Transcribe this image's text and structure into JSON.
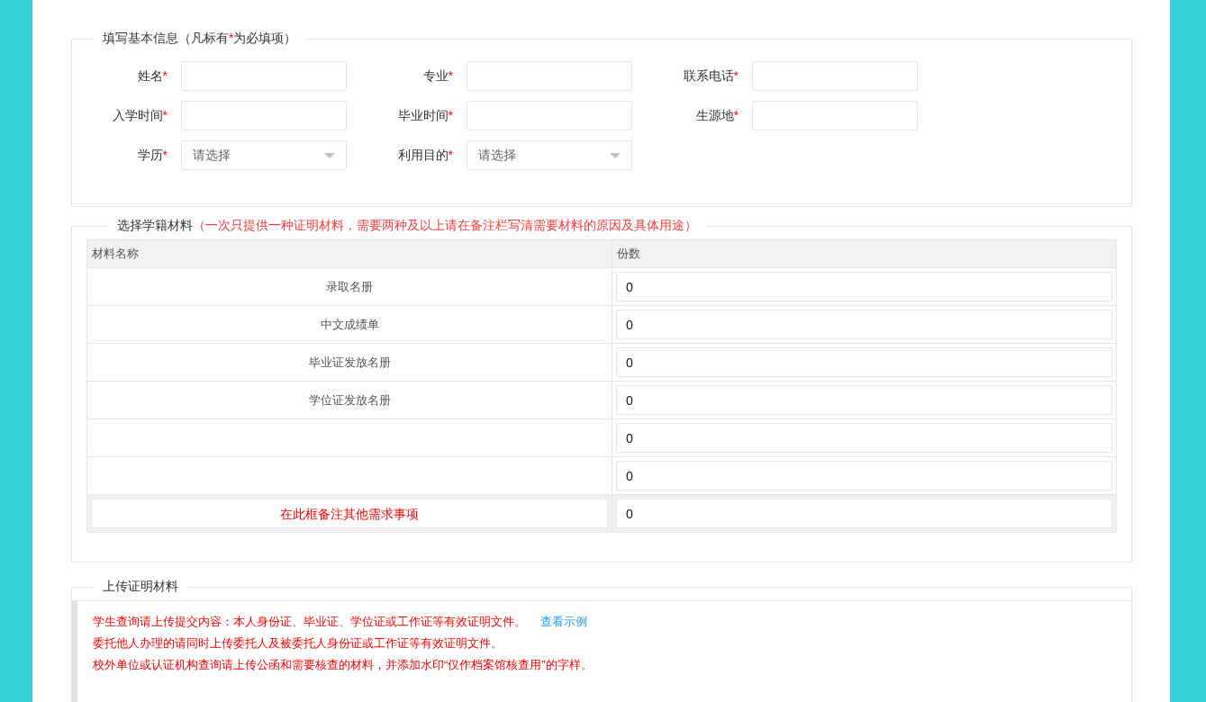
{
  "basic_info": {
    "legend": [
      {
        "text": "填写基本信息（凡标有",
        "kind": "normal"
      },
      {
        "text": "*",
        "kind": "required"
      },
      {
        "text": "为必填项）",
        "kind": "normal"
      }
    ],
    "rows": [
      [
        {
          "label": "姓名",
          "required": true,
          "kind": "text"
        },
        {
          "label": "专业",
          "required": true,
          "kind": "text"
        },
        {
          "label": "联系电话",
          "required": true,
          "kind": "text"
        }
      ],
      [
        {
          "label": "入学时间",
          "required": true,
          "kind": "text"
        },
        {
          "label": "毕业时间",
          "required": true,
          "kind": "text"
        },
        {
          "label": "生源地",
          "required": true,
          "kind": "text"
        }
      ],
      [
        {
          "label": "学历",
          "required": true,
          "kind": "select",
          "placeholder": "请选择"
        },
        {
          "label": "利用目的",
          "required": true,
          "kind": "select",
          "placeholder": "请选择"
        }
      ]
    ]
  },
  "materials": {
    "legend": "选择学籍材料",
    "legend_note": "（一次只提供一种证明材料，需要两种及以上请在备注栏写清需要材料的原因及具体用途）",
    "columns": [
      "材料名称",
      "份数"
    ],
    "rows": [
      {
        "name": "录取名册",
        "count": "0"
      },
      {
        "name": "中文成绩单",
        "count": "0"
      },
      {
        "name": "毕业证发放名册",
        "count": "0"
      },
      {
        "name": "学位证发放名册",
        "count": "0"
      },
      {
        "count": "0"
      },
      {
        "count": "0"
      }
    ],
    "remark": {
      "placeholder": "在此框备注其他需求事项",
      "count": "0"
    }
  },
  "upload": {
    "legend": "上传证明材料",
    "notes": [
      {
        "text": "学生查询请上传提交内容：本人身份证、毕业证、学位证或工作证等有效证明文件。",
        "link": "查看示例"
      },
      {
        "text": "委托他人办理的请同时上传委托人及被委托人身份证或工作证等有效证明文件。"
      },
      {
        "text": "校外单位或认证机构查询请上传公函和需要核查的材料，并添加水印“仅作档案馆核查用”的字样。"
      }
    ]
  }
}
